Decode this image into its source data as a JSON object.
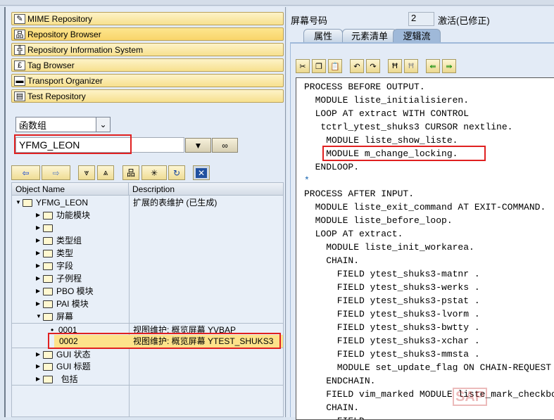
{
  "nav": [
    {
      "label": "MIME Repository",
      "icon": "mime-icon"
    },
    {
      "label": "Repository Browser",
      "icon": "hierarchy-icon",
      "active": true
    },
    {
      "label": "Repository Information System",
      "icon": "info-system-icon"
    },
    {
      "label": "Tag Browser",
      "icon": "tag-icon"
    },
    {
      "label": "Transport Organizer",
      "icon": "truck-icon"
    },
    {
      "label": "Test Repository",
      "icon": "test-icon"
    }
  ],
  "object_type": "函数组",
  "object_name": "YFMG_LEON",
  "tree": {
    "headers": [
      "Object Name",
      "Description"
    ],
    "root": {
      "name": "YFMG_LEON",
      "desc": "扩展的表维护 (已生成)"
    },
    "folders": [
      "功能模块",
      "",
      "类型组",
      "类型",
      "字段",
      "子例程",
      "PBO 模块",
      "PAI 模块"
    ],
    "screens_folder": "屏幕",
    "screens": [
      {
        "name": "0001",
        "desc": "视图维护: 概览屏幕 YVBAP"
      },
      {
        "name": "0002",
        "desc": "视图维护: 概览屏幕 YTEST_SHUKS3"
      }
    ],
    "folders_after": [
      "GUI 状态",
      "GUI 标题",
      "  包括"
    ]
  },
  "screen": {
    "label": "屏幕号码",
    "number": "2",
    "status": "激活(已修正)"
  },
  "tabs": [
    "属性",
    "元素清单",
    "逻辑流"
  ],
  "active_tab": "逻辑流",
  "code": [
    "PROCESS BEFORE OUTPUT.",
    "  MODULE liste_initialisieren.",
    "  LOOP AT extract WITH CONTROL",
    "   tctrl_ytest_shuks3 CURSOR nextline.",
    "    MODULE liste_show_liste.",
    "    MODULE m_change_locking.",
    "  ENDLOOP.",
    "*",
    "PROCESS AFTER INPUT.",
    "  MODULE liste_exit_command AT EXIT-COMMAND.",
    "  MODULE liste_before_loop.",
    "  LOOP AT extract.",
    "    MODULE liste_init_workarea.",
    "    CHAIN.",
    "      FIELD ytest_shuks3-matnr .",
    "      FIELD ytest_shuks3-werks .",
    "      FIELD ytest_shuks3-pstat .",
    "      FIELD ytest_shuks3-lvorm .",
    "      FIELD ytest_shuks3-bwtty .",
    "      FIELD ytest_shuks3-xchar .",
    "      FIELD ytest_shuks3-mmsta .",
    "      MODULE set_update_flag ON CHAIN-REQUEST",
    "    ENDCHAIN.",
    "    FIELD vim_marked MODULE liste_mark_checkbox.",
    "    CHAIN.",
    "      FIELD"
  ],
  "watermark": "SAP",
  "colors": {
    "highlight": "#fde28a",
    "annotation": "#e02020",
    "comment": "#1060b0"
  }
}
